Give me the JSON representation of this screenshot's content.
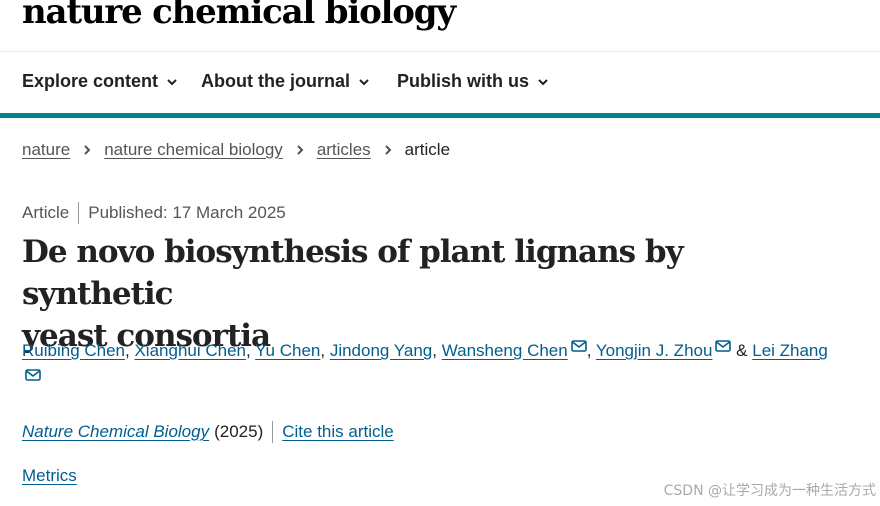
{
  "brand": {
    "logo_text": "nature chemical biology"
  },
  "nav": {
    "items": [
      {
        "label": "Explore content"
      },
      {
        "label": "About the journal"
      },
      {
        "label": "Publish with us"
      }
    ]
  },
  "breadcrumb": {
    "items": [
      "nature",
      "nature chemical biology",
      "articles"
    ],
    "current": "article"
  },
  "article": {
    "type": "Article",
    "published": "Published: 17 March 2025",
    "title_line1": "De novo biosynthesis of plant lignans by synthetic",
    "title_line2": "yeast consortia",
    "authors": [
      {
        "name": "Ruibing Chen",
        "sep": ", "
      },
      {
        "name": "Xianghui Chen",
        "sep": ", "
      },
      {
        "name": "Yu Chen",
        "sep": ", "
      },
      {
        "name": "Jindong Yang",
        "sep": ", "
      },
      {
        "name": "Wansheng Chen",
        "sep": ", "
      },
      {
        "name": "Yongjin J. Zhou",
        "sep": " & "
      },
      {
        "name": "Lei Zhang",
        "sep": ""
      }
    ],
    "journal": "Nature Chemical Biology",
    "year": "(2025)",
    "cite_label": "Cite this article",
    "metrics_label": "Metrics"
  },
  "watermark": "CSDN @让学习成为一种生活方式",
  "colors": {
    "accent_teal": "#03848e",
    "link_blue": "#025e8d",
    "text_dark": "#222222",
    "text_muted": "#555555"
  },
  "icons": {
    "nav_chevron": "chevron-down-icon",
    "crumb_separator": "chevron-right-icon",
    "corresponding_author": "mail-icon"
  }
}
